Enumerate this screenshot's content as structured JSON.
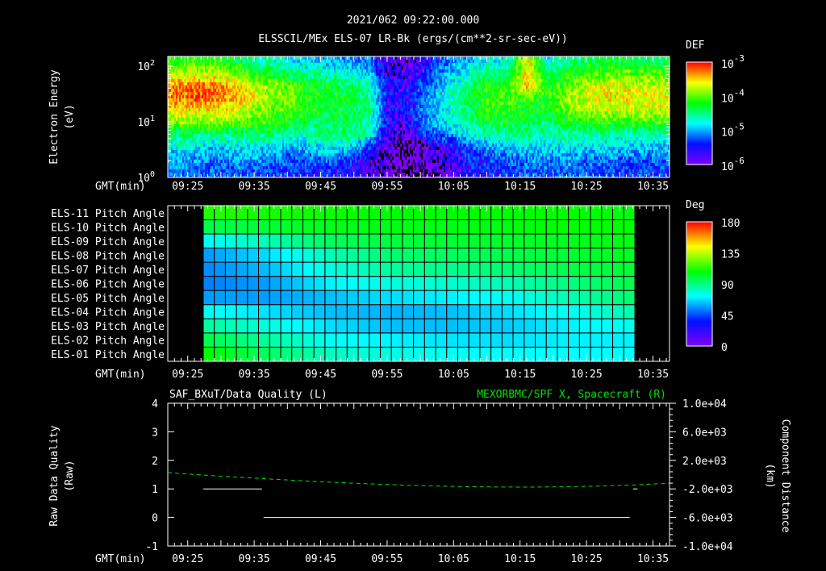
{
  "header": {
    "timestamp": "2021/062 09:22:00.000",
    "title": "ELSSCIL/MEx ELS-07 LR-Bk  (ergs/(cm**2-sr-sec-eV))"
  },
  "colors": {
    "background": "#000000",
    "axis": "#ffffff",
    "right_series": "#00e000"
  },
  "chart_data": [
    {
      "type": "heatmap",
      "name": "electron-spectrogram",
      "ylabel_line1": "Electron Energy",
      "ylabel_line2": "(eV)",
      "xlabel": "GMT(min)",
      "x_tick_labels": [
        "09:25",
        "09:35",
        "09:45",
        "09:55",
        "10:05",
        "10:15",
        "10:25",
        "10:35"
      ],
      "y_tick_labels": [
        {
          "base": "10",
          "exp": "0"
        },
        {
          "base": "10",
          "exp": "1"
        },
        {
          "base": "10",
          "exp": "2"
        }
      ],
      "ylim_eV": [
        1,
        145
      ],
      "xlim": [
        "09:22",
        "10:37:30"
      ],
      "colorbar": {
        "label": "DEF",
        "scale": "log",
        "range_log10": [
          -6.3,
          -3
        ],
        "ticks": [
          {
            "base": "10",
            "exp": "-3"
          },
          {
            "base": "10",
            "exp": "-4"
          },
          {
            "base": "10",
            "exp": "-5"
          },
          {
            "base": "10",
            "exp": "-6"
          }
        ]
      },
      "time_bins_start": [
        "09:22",
        "09:25",
        "09:28",
        "09:31",
        "09:34",
        "09:37",
        "09:40",
        "09:43",
        "09:46",
        "09:49",
        "09:52",
        "09:55",
        "09:58",
        "10:01",
        "10:04",
        "10:07",
        "10:10",
        "10:13",
        "10:16",
        "10:19",
        "10:22",
        "10:25",
        "10:28",
        "10:31",
        "10:34"
      ],
      "energy_bins_eV": [
        1.3,
        2.2,
        3.7,
        6,
        10,
        17,
        28,
        47,
        80,
        130
      ],
      "log10_def": [
        [
          -5.6,
          -5.6,
          -5.7,
          -5.7,
          -5.7,
          -5.8,
          -5.8,
          -5.9,
          -5.9,
          -6.0,
          -6.2,
          -6.4,
          -6.6,
          -6.5,
          -6.3,
          -6.0,
          -5.9,
          -5.8,
          -5.7,
          -5.7,
          -5.6,
          -5.7,
          -5.7,
          -5.8,
          -5.8
        ],
        [
          -5.5,
          -5.5,
          -5.6,
          -5.6,
          -5.5,
          -5.6,
          -5.7,
          -5.7,
          -5.6,
          -5.8,
          -6.1,
          -6.4,
          -6.6,
          -6.4,
          -6.2,
          -5.9,
          -5.8,
          -5.7,
          -5.6,
          -5.6,
          -5.5,
          -5.6,
          -5.6,
          -5.7,
          -5.7
        ],
        [
          -5.2,
          -5.2,
          -5.3,
          -5.3,
          -5.2,
          -5.3,
          -5.4,
          -5.4,
          -5.2,
          -5.3,
          -5.8,
          -6.4,
          -6.6,
          -6.3,
          -6.0,
          -5.8,
          -5.5,
          -5.4,
          -5.3,
          -5.3,
          -5.2,
          -5.3,
          -5.3,
          -5.3,
          -5.4
        ],
        [
          -4.8,
          -4.8,
          -4.9,
          -4.9,
          -4.8,
          -4.8,
          -5.0,
          -5.0,
          -4.8,
          -4.8,
          -5.0,
          -6.2,
          -6.3,
          -5.8,
          -5.6,
          -5.3,
          -5.0,
          -4.9,
          -4.9,
          -5.0,
          -4.9,
          -4.9,
          -5.0,
          -5.0,
          -5.0
        ],
        [
          -4.2,
          -4.1,
          -4.1,
          -4.2,
          -4.3,
          -4.4,
          -4.5,
          -4.7,
          -4.7,
          -4.8,
          -4.9,
          -6.0,
          -6.1,
          -5.5,
          -5.2,
          -4.9,
          -4.6,
          -4.6,
          -4.7,
          -4.8,
          -4.6,
          -4.5,
          -4.4,
          -4.4,
          -4.4
        ],
        [
          -3.8,
          -3.7,
          -3.7,
          -3.8,
          -4.0,
          -4.2,
          -4.3,
          -4.5,
          -4.6,
          -4.6,
          -4.8,
          -6.0,
          -6.0,
          -5.5,
          -5.1,
          -4.8,
          -4.4,
          -4.4,
          -4.5,
          -4.6,
          -4.2,
          -4.0,
          -3.9,
          -3.9,
          -3.9
        ],
        [
          -3.4,
          -3.3,
          -3.3,
          -3.4,
          -3.7,
          -4.0,
          -4.1,
          -4.4,
          -4.5,
          -4.6,
          -4.8,
          -6.0,
          -6.0,
          -5.5,
          -5.1,
          -4.7,
          -4.3,
          -4.3,
          -4.4,
          -4.4,
          -4.1,
          -3.8,
          -3.7,
          -3.7,
          -3.8
        ],
        [
          -3.4,
          -3.3,
          -3.3,
          -3.5,
          -3.8,
          -4.1,
          -4.2,
          -4.5,
          -4.6,
          -4.7,
          -4.9,
          -6.0,
          -6.0,
          -5.6,
          -5.2,
          -4.8,
          -4.4,
          -4.4,
          -3.5,
          -4.5,
          -4.2,
          -3.9,
          -3.8,
          -3.8,
          -3.9
        ],
        [
          -4.0,
          -3.9,
          -3.9,
          -4.0,
          -4.3,
          -4.5,
          -4.7,
          -4.9,
          -5.0,
          -5.1,
          -5.3,
          -6.2,
          -6.2,
          -5.8,
          -5.4,
          -5.1,
          -4.8,
          -4.8,
          -3.6,
          -4.8,
          -4.5,
          -4.3,
          -4.2,
          -4.2,
          -4.3
        ],
        [
          -4.4,
          -4.4,
          -4.4,
          -4.5,
          -4.8,
          -5.0,
          -5.2,
          -5.3,
          -5.4,
          -5.5,
          -5.6,
          -6.3,
          -6.3,
          -6.0,
          -5.6,
          -5.4,
          -5.2,
          -5.1,
          -3.7,
          -5.2,
          -4.9,
          -4.7,
          -4.6,
          -4.6,
          -4.7
        ]
      ]
    },
    {
      "type": "heatmap",
      "name": "pitch-angle",
      "xlabel": "GMT(min)",
      "x_tick_labels": [
        "09:25",
        "09:35",
        "09:45",
        "09:55",
        "10:05",
        "10:15",
        "10:25",
        "10:35"
      ],
      "row_labels": [
        "ELS-11 Pitch Angle",
        "ELS-10 Pitch Angle",
        "ELS-09 Pitch Angle",
        "ELS-08 Pitch Angle",
        "ELS-07 Pitch Angle",
        "ELS-06 Pitch Angle",
        "ELS-05 Pitch Angle",
        "ELS-04 Pitch Angle",
        "ELS-03 Pitch Angle",
        "ELS-02 Pitch Angle",
        "ELS-01 Pitch Angle"
      ],
      "data_time_range": [
        "09:27:20",
        "10:32:20"
      ],
      "columns": 39,
      "colorbar": {
        "label": "Deg",
        "range": [
          0,
          180
        ],
        "ticks": [
          "180",
          "135",
          "90",
          "45",
          "0"
        ]
      },
      "pitch_angle_deg_control_points": [
        [
          105,
          103,
          102,
          100,
          100,
          100,
          100,
          98
        ],
        [
          88,
          92,
          96,
          97,
          97,
          98,
          100,
          100
        ],
        [
          62,
          72,
          85,
          90,
          92,
          93,
          95,
          97
        ],
        [
          45,
          55,
          72,
          82,
          85,
          88,
          92,
          95
        ],
        [
          42,
          50,
          65,
          75,
          78,
          82,
          88,
          92
        ],
        [
          40,
          45,
          58,
          65,
          68,
          72,
          80,
          88
        ],
        [
          45,
          45,
          50,
          55,
          58,
          62,
          72,
          82
        ],
        [
          62,
          55,
          50,
          48,
          50,
          55,
          62,
          72
        ],
        [
          75,
          65,
          55,
          50,
          50,
          52,
          58,
          62
        ],
        [
          88,
          75,
          62,
          58,
          56,
          55,
          58,
          58
        ],
        [
          100,
          85,
          70,
          65,
          62,
          60,
          60,
          60
        ]
      ]
    },
    {
      "type": "line",
      "name": "data-quality-and-position",
      "left_title": "SAF_BXuT/Data Quality (L)",
      "right_title": "MEXORBMC/SPF X, Spacecraft (R)",
      "ylabel_line1": "Raw Data Quality",
      "ylabel_line2": "(Raw)",
      "y2label_line1": "Component Distance",
      "y2label_line2": "(km)",
      "xlabel": "GMT(min)",
      "x_tick_labels": [
        "09:25",
        "09:35",
        "09:45",
        "09:55",
        "10:05",
        "10:15",
        "10:25",
        "10:35"
      ],
      "ylim": [
        -1,
        4
      ],
      "y_tick_labels": [
        "4",
        "3",
        "2",
        "1",
        "0",
        "-1"
      ],
      "y2lim": [
        -10000,
        10000
      ],
      "y2_tick_labels": [
        "1.0e+04",
        "6.0e+03",
        "2.0e+03",
        "-2.0e+03",
        "-6.0e+03",
        "-1.0e+04"
      ],
      "series": [
        {
          "name": "Data Quality",
          "axis": "left",
          "segments": [
            {
              "x": [
                "09:27:20",
                "09:36:10"
              ],
              "y": 1
            },
            {
              "x": [
                "09:36:25",
                "10:31:30"
              ],
              "y": 0
            },
            {
              "x": [
                "10:32:00",
                "10:32:40"
              ],
              "y": 1
            }
          ]
        },
        {
          "name": "SPF X",
          "axis": "right",
          "style": "dashed",
          "x_min": [
            22,
            27,
            32,
            37,
            42,
            47,
            52,
            57,
            62,
            67,
            72,
            77,
            82,
            87,
            92,
            97.5
          ],
          "y_km": [
            280,
            -40,
            -330,
            -600,
            -850,
            -1080,
            -1280,
            -1450,
            -1590,
            -1690,
            -1740,
            -1750,
            -1700,
            -1600,
            -1440,
            -1220
          ]
        }
      ]
    }
  ]
}
